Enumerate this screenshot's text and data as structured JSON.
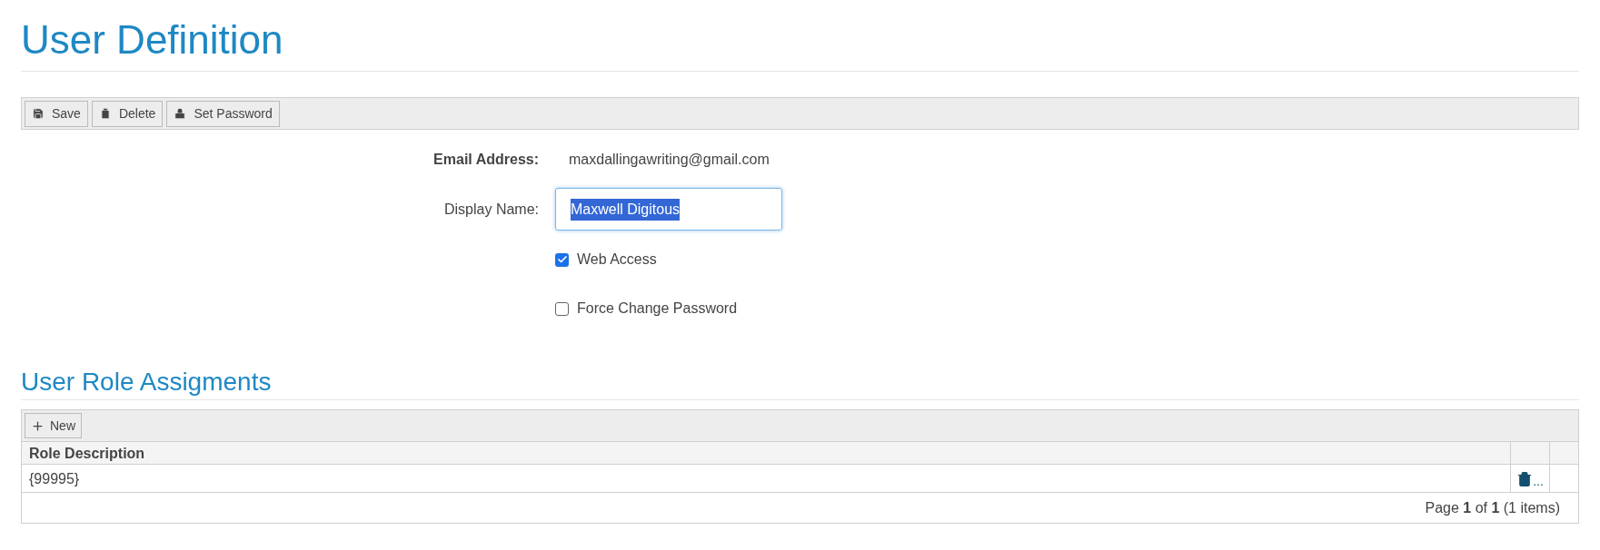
{
  "title": "User Definition",
  "toolbar": [
    {
      "kind": "save",
      "label": "Save"
    },
    {
      "kind": "delete",
      "label": "Delete"
    },
    {
      "kind": "lock",
      "label": "Set Password"
    }
  ],
  "form": {
    "email": {
      "label": "Email Address:",
      "value": "maxdallingawriting@gmail.com"
    },
    "display_name": {
      "label": "Display Name:",
      "value": "Maxwell Digitous",
      "value_selected": true
    },
    "checkboxes": [
      {
        "label": "Web Access",
        "checked": true
      },
      {
        "label": "Force Change Password",
        "checked": false
      }
    ]
  },
  "roles": {
    "title": "User Role Assigments",
    "new_button": "New",
    "columns": [
      "Role Description"
    ],
    "rows": [
      {
        "cells": [
          "{99995}"
        ],
        "action_text": "..."
      }
    ],
    "pager": "Page **1** of **1** (1 items)"
  }
}
